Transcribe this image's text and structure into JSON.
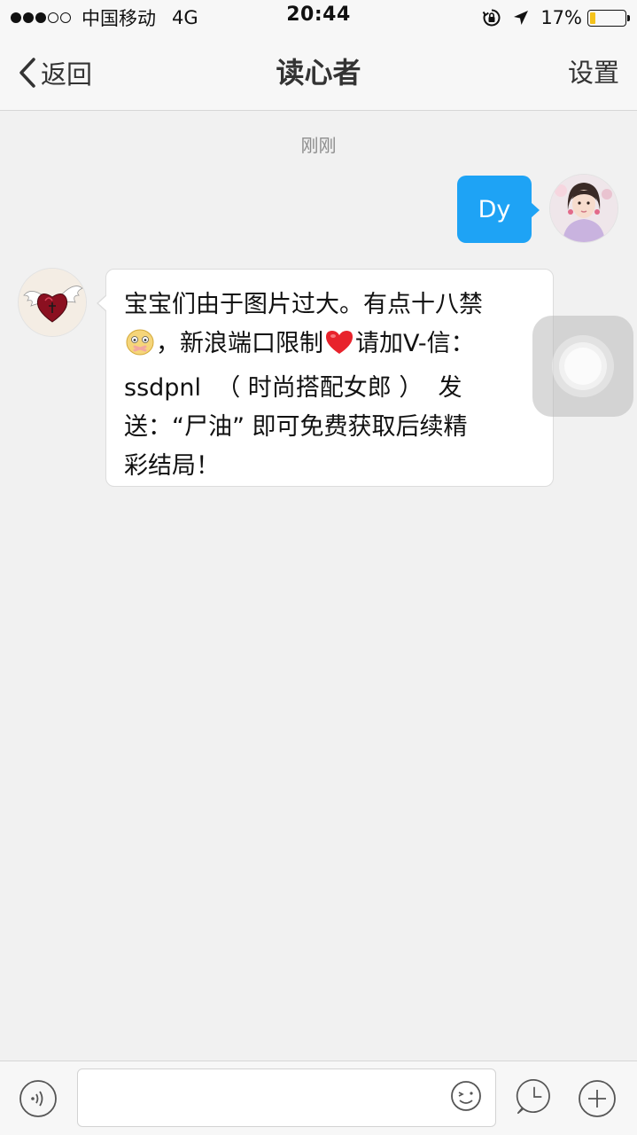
{
  "status_bar": {
    "signal_dots_filled": 3,
    "signal_dots_total": 5,
    "carrier": "中国移动",
    "network": "4G",
    "time": "20:44",
    "battery_percent": "17%",
    "battery_level": 0.17,
    "battery_color": "#f4c21b",
    "icons": [
      "rotation-lock-icon",
      "location-arrow-icon",
      "battery-icon"
    ]
  },
  "nav": {
    "back_label": "返回",
    "title": "读心者",
    "settings_label": "设置"
  },
  "chat": {
    "timestamp": "刚刚",
    "messages": [
      {
        "direction": "outgoing",
        "text": "Dy",
        "bubble_color": "#1ea3f5",
        "avatar": "user-avatar-woman-photo"
      },
      {
        "direction": "incoming",
        "avatar": "winged-heart-avatar",
        "lines": [
          "宝宝们由于图片过大。有点十八禁",
          "，新浪端口限制",
          "请加V-信：",
          "ssdpnl  （ 时尚搭配女郎 ）  发",
          "送：“尸油” 即可免费获取后续精",
          "彩结局！"
        ],
        "emojis": [
          "shy-face-emoji",
          "red-heart-emoji"
        ]
      }
    ]
  },
  "input_bar": {
    "placeholder": "",
    "icons": [
      "voice-icon",
      "emoji-icon",
      "history-clock-icon",
      "plus-icon"
    ]
  }
}
